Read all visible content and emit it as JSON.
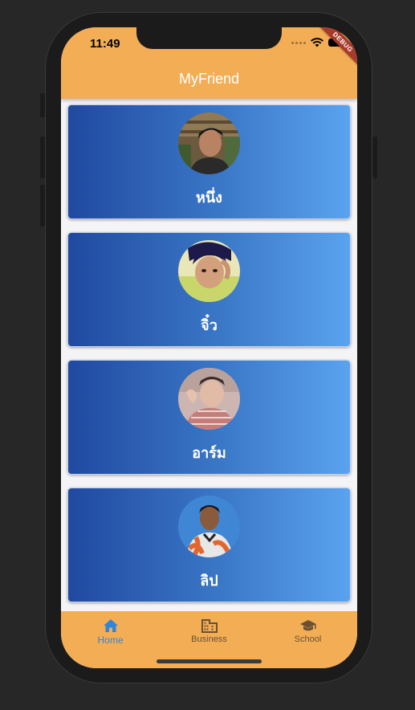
{
  "status_bar": {
    "time": "11:49",
    "debug_label": "DEBUG"
  },
  "app_bar": {
    "title": "MyFriend"
  },
  "friends": [
    {
      "name": "หนึ่ง",
      "avatar_icon": "person-photo-icon"
    },
    {
      "name": "จิ๋ว",
      "avatar_icon": "person-photo-icon"
    },
    {
      "name": "อาร์ม",
      "avatar_icon": "person-photo-icon"
    },
    {
      "name": "ลิป",
      "avatar_icon": "person-photo-icon"
    }
  ],
  "bottom_nav": {
    "items": [
      {
        "label": "Home",
        "icon": "home-icon",
        "active": true
      },
      {
        "label": "Business",
        "icon": "business-icon",
        "active": false
      },
      {
        "label": "School",
        "icon": "school-icon",
        "active": false
      }
    ]
  },
  "colors": {
    "app_bar": "#f3ad55",
    "card_gradient_start": "#2049a0",
    "card_gradient_end": "#5aa3ef",
    "active_nav": "#2f86d8"
  }
}
